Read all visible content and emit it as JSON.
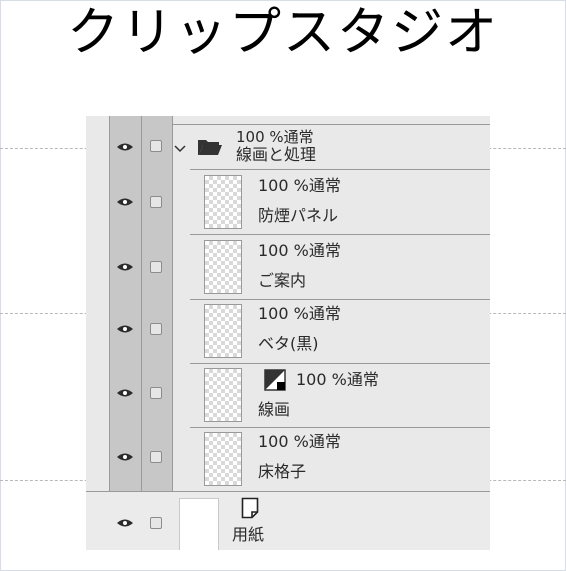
{
  "title": "クリップスタジオ",
  "panel": {
    "top_partial_label": "",
    "folder": {
      "blend": "100 %通常",
      "name": "線画と処理"
    },
    "layers": [
      {
        "blend": "100 %通常",
        "name": "防煙パネル"
      },
      {
        "blend": "100 %通常",
        "name": "ご案内"
      },
      {
        "blend": "100 %通常",
        "name": "ベタ(黒)"
      },
      {
        "blend": "100 %通常",
        "name": "線画"
      },
      {
        "blend": "100 %通常",
        "name": "床格子"
      }
    ],
    "paper": {
      "name": "用紙"
    }
  },
  "colors": {
    "panel_bg": "#e9e9e9",
    "column_bg": "#c7c7c7",
    "divider": "#9a9a9a"
  }
}
